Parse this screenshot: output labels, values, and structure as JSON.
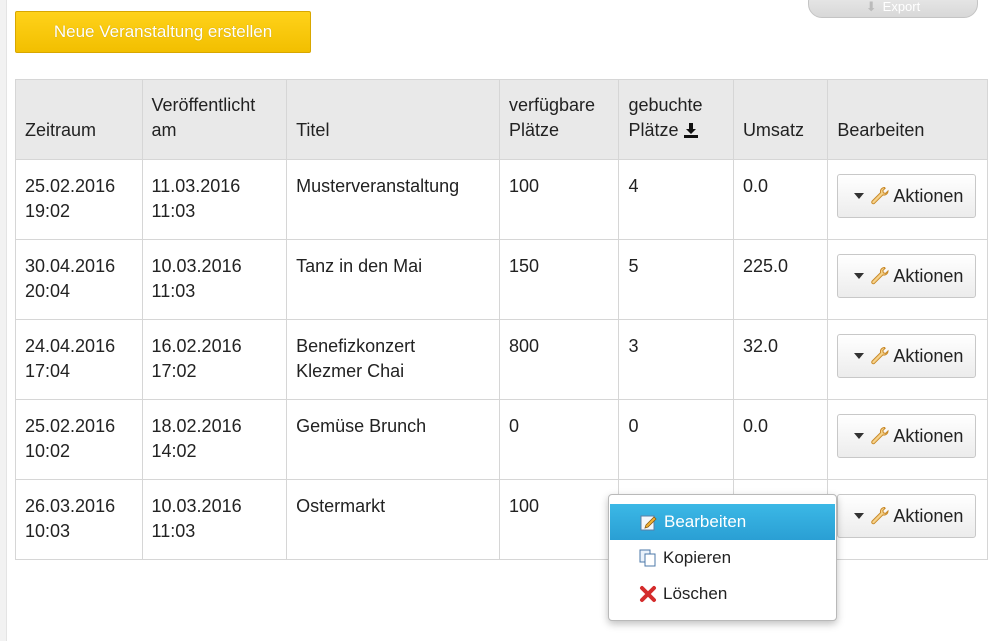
{
  "toolbar": {
    "create_label": "Neue Veranstaltung erstellen",
    "export_label": "Export"
  },
  "table": {
    "headers": {
      "zeitraum": "Zeitraum",
      "veroeffentlicht_line1": "Veröffentlicht",
      "veroeffentlicht_line2": "am",
      "titel": "Titel",
      "verfuegbar_line1": "verfügbare",
      "verfuegbar_line2": "Plätze",
      "gebucht_line1": "gebuchte",
      "gebucht_line2": "Plätze",
      "umsatz": "Umsatz",
      "bearbeiten": "Bearbeiten"
    },
    "rows": [
      {
        "zeit_date": "25.02.2016",
        "zeit_time": "19:02",
        "ver_date": "11.03.2016",
        "ver_time": "11:03",
        "titel_line1": "Musterveranstaltung",
        "titel_line2": "",
        "verfuegbar": "100",
        "gebucht": "4",
        "umsatz": "0.0",
        "action": "Aktionen"
      },
      {
        "zeit_date": "30.04.2016",
        "zeit_time": "20:04",
        "ver_date": "10.03.2016",
        "ver_time": "11:03",
        "titel_line1": "Tanz in den Mai",
        "titel_line2": "",
        "verfuegbar": "150",
        "gebucht": "5",
        "umsatz": "225.0",
        "action": "Aktionen"
      },
      {
        "zeit_date": "24.04.2016",
        "zeit_time": "17:04",
        "ver_date": "16.02.2016",
        "ver_time": "17:02",
        "titel_line1": "Benefizkonzert",
        "titel_line2": "Klezmer Chai",
        "verfuegbar": "800",
        "gebucht": "3",
        "umsatz": "32.0",
        "action": "Aktionen"
      },
      {
        "zeit_date": "25.02.2016",
        "zeit_time": "10:02",
        "ver_date": "18.02.2016",
        "ver_time": "14:02",
        "titel_line1": "Gemüse Brunch",
        "titel_line2": "",
        "verfuegbar": "0",
        "gebucht": "0",
        "umsatz": "0.0",
        "action": "Aktionen"
      },
      {
        "zeit_date": "26.03.2016",
        "zeit_time": "10:03",
        "ver_date": "10.03.2016",
        "ver_time": "11:03",
        "titel_line1": "Ostermarkt",
        "titel_line2": "",
        "verfuegbar": "100",
        "gebucht": "",
        "umsatz": "",
        "action": "Aktionen"
      }
    ]
  },
  "dropdown_menu": {
    "items": [
      {
        "label": "Bearbeiten",
        "icon": "edit-icon",
        "active": true
      },
      {
        "label": "Kopieren",
        "icon": "copy-icon",
        "active": false
      },
      {
        "label": "Löschen",
        "icon": "delete-icon",
        "active": false
      }
    ]
  },
  "colors": {
    "primary_button": "#f2bf00",
    "menu_highlight": "#2a9fd4",
    "header_bg": "#e9e9e9"
  }
}
